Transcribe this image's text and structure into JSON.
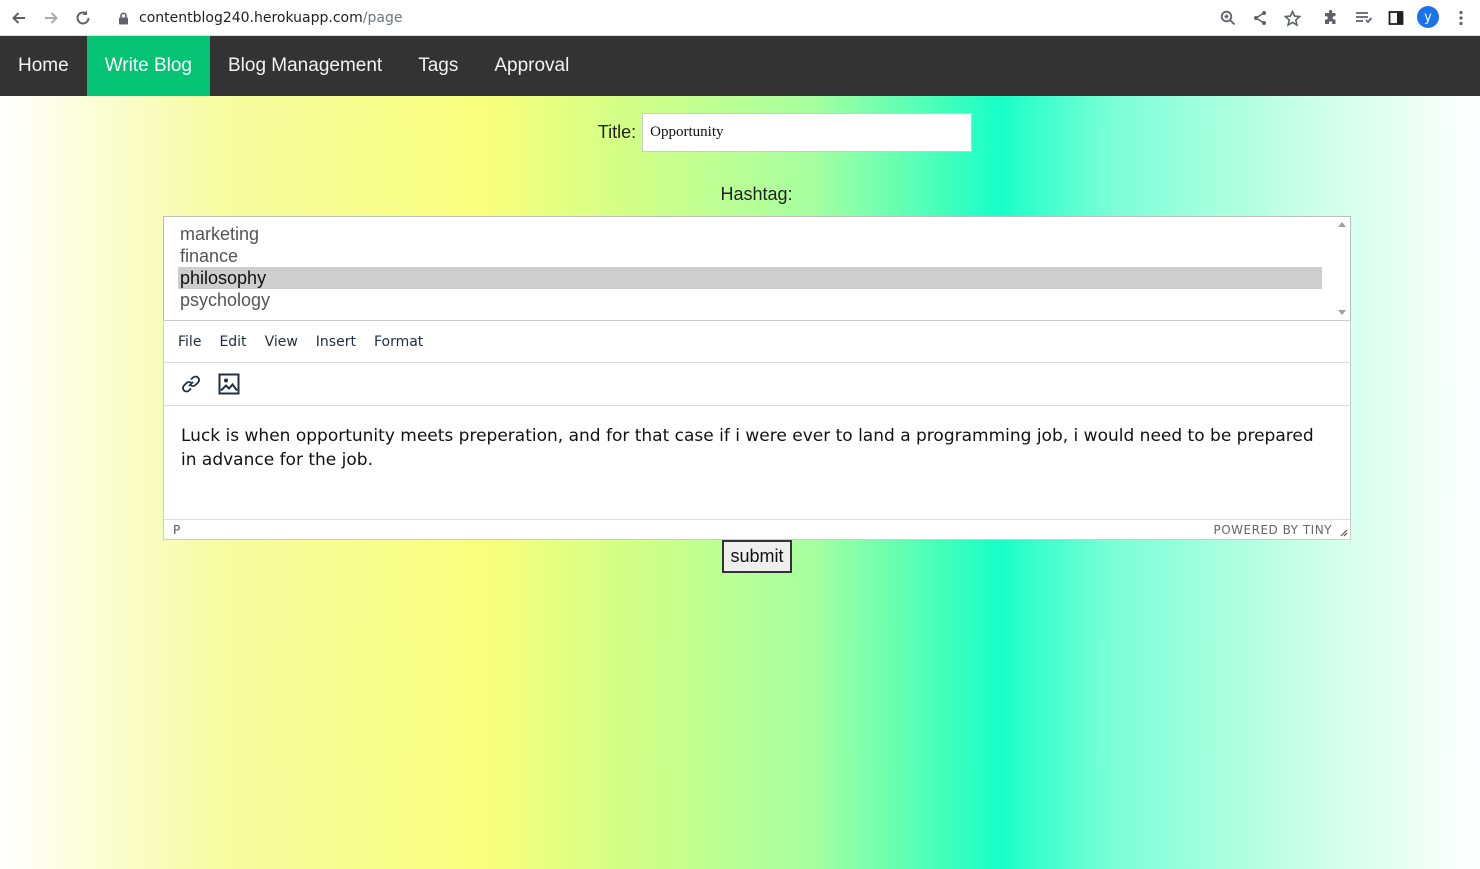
{
  "browser": {
    "url_host": "contentblog240.herokuapp.com",
    "url_path": "/page",
    "avatar_letter": "y",
    "icons": [
      "back-arrow-icon",
      "forward-arrow-icon",
      "reload-icon",
      "lock-icon",
      "zoom-icon",
      "share-icon",
      "star-icon",
      "extensions-icon",
      "reading-list-icon",
      "side-panel-icon",
      "menu-dots-icon"
    ]
  },
  "nav": {
    "items": [
      {
        "label": "Home",
        "active": false
      },
      {
        "label": "Write Blog",
        "active": true
      },
      {
        "label": "Blog Management",
        "active": false
      },
      {
        "label": "Tags",
        "active": false
      },
      {
        "label": "Approval",
        "active": false
      }
    ],
    "active_color": "#04c375"
  },
  "form": {
    "title_label": "Title:",
    "title_value": "Opportunity",
    "hashtag_label": "Hashtag:",
    "hashtags": [
      "marketing",
      "finance",
      "philosophy",
      "psychology"
    ],
    "selected_hashtag": "philosophy",
    "submit_label": "submit"
  },
  "editor": {
    "menu": [
      "File",
      "Edit",
      "View",
      "Insert",
      "Format"
    ],
    "tools": [
      "link-icon",
      "image-icon"
    ],
    "content": "Luck is when opportunity meets preperation, and for that case if i were ever to land a programming job, i would need to be prepared in advance for the job.",
    "path": "P",
    "powered_by": "POWERED BY TINY"
  }
}
